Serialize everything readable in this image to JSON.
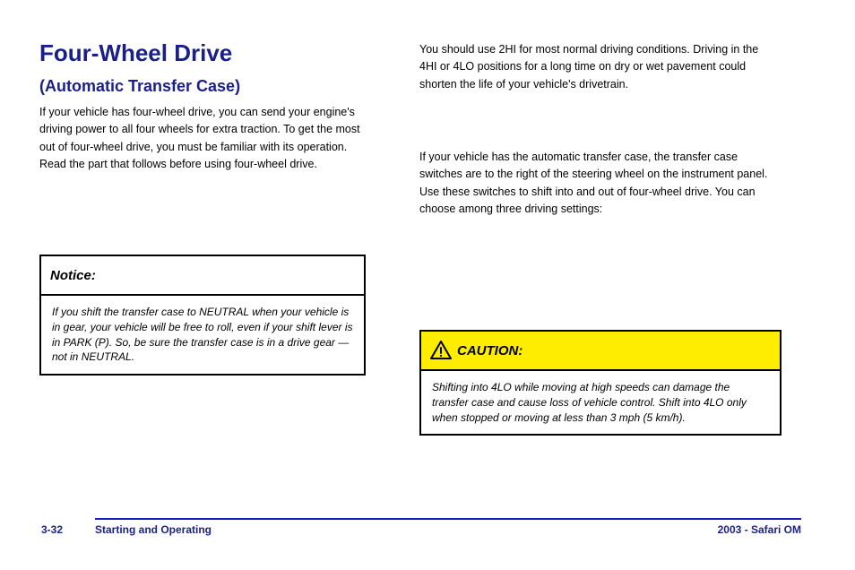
{
  "page": {
    "number": "3-32",
    "footer_left": "Starting and Operating",
    "footer_right": "2003 - Safari OM"
  },
  "title": "Four-Wheel Drive",
  "subtitle": "(Automatic Transfer Case)",
  "paragraphs": {
    "p1": "If your vehicle has four-wheel drive, you can send your engine's driving power to all four wheels for extra traction. To get the most out of four-wheel drive, you must be familiar with its operation. Read the part that follows before using four-wheel drive.",
    "p2": "You should use 2HI for most normal driving conditions. Driving in the 4HI or 4LO positions for a long time on dry or wet pavement could shorten the life of your vehicle's drivetrain.",
    "p3": "If your vehicle has the automatic transfer case, the transfer case switches are to the right of the steering wheel on the instrument panel. Use these switches to shift into and out of four-wheel drive. You can choose among three driving settings:"
  },
  "box_left": {
    "header": "Notice:",
    "body": "If you shift the transfer case to NEUTRAL when your vehicle is in gear, your vehicle will be free to roll, even if your shift lever is in PARK (P). So, be sure the transfer case is in a drive gear — not in NEUTRAL."
  },
  "box_right": {
    "header_label": "CAUTION:",
    "body": "Shifting into 4LO while moving at high speeds can damage the transfer case and cause loss of vehicle control. Shift into 4LO only when stopped or moving at less than 3 mph (5 km/h)."
  }
}
